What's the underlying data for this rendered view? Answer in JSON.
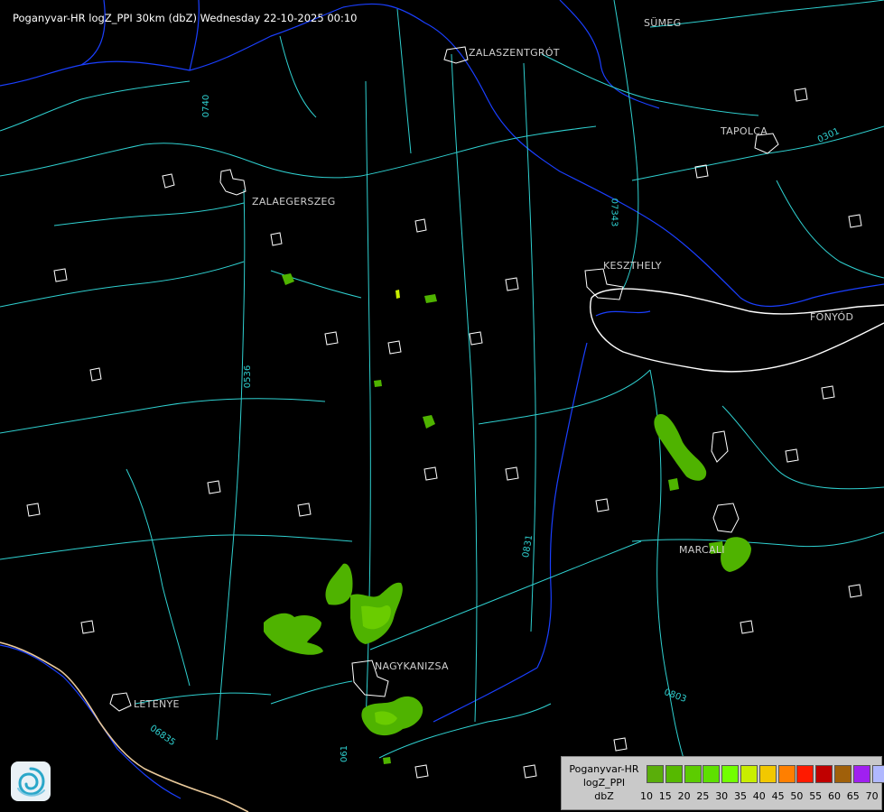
{
  "title": "Poganyvar-HR logZ_PPI 30km (dbZ) Wednesday 22-10-2025 00:10",
  "cities": [
    {
      "id": "sumeg",
      "name": "SÜMEG"
    },
    {
      "id": "zalaszentgrot",
      "name": "ZALASZENTGRÓT"
    },
    {
      "id": "tapolca",
      "name": "TAPOLCA"
    },
    {
      "id": "zalaegerszeg",
      "name": "ZALAEGERSZEG"
    },
    {
      "id": "keszthely",
      "name": "KESZTHELY"
    },
    {
      "id": "fonyod",
      "name": "FONYÓD"
    },
    {
      "id": "marcali",
      "name": "MARCALI"
    },
    {
      "id": "nagykanizsa",
      "name": "NAGYKANIZSA"
    },
    {
      "id": "letenye",
      "name": "LETENYE"
    }
  ],
  "roads": [
    {
      "id": "r0740",
      "label": "0740"
    },
    {
      "id": "r07343",
      "label": "07343"
    },
    {
      "id": "r0301",
      "label": "0301"
    },
    {
      "id": "r0536",
      "label": "0536"
    },
    {
      "id": "r0831",
      "label": "0831"
    },
    {
      "id": "r0803",
      "label": "0803"
    },
    {
      "id": "r06835",
      "label": "06835"
    },
    {
      "id": "r061",
      "label": "061"
    }
  ],
  "legend": {
    "line1": "Poganyvar-HR",
    "line2": "logZ_PPI",
    "line3": "dbZ",
    "scale": [
      {
        "value": "10",
        "color": "#5aae0a"
      },
      {
        "value": "15",
        "color": "#56b900"
      },
      {
        "value": "20",
        "color": "#5ccc00"
      },
      {
        "value": "25",
        "color": "#5ee000"
      },
      {
        "value": "30",
        "color": "#72ff00"
      },
      {
        "value": "35",
        "color": "#c8ee00"
      },
      {
        "value": "40",
        "color": "#f2c800"
      },
      {
        "value": "45",
        "color": "#ff7f00"
      },
      {
        "value": "50",
        "color": "#ff1a00"
      },
      {
        "value": "55",
        "color": "#c00000"
      },
      {
        "value": "60",
        "color": "#a0600a"
      },
      {
        "value": "65",
        "color": "#a020f0"
      },
      {
        "value": "70",
        "color": "#b0b8ff"
      }
    ]
  },
  "colors": {
    "background": "#000000",
    "roads": "#2fd0d0",
    "rivers": "#1a3fff",
    "settlements": "#ffffff",
    "lake_shore": "#ffffff",
    "border": "#e8c89a",
    "echo_weak": "#4fb300",
    "echo_medium": "#6acc00"
  }
}
